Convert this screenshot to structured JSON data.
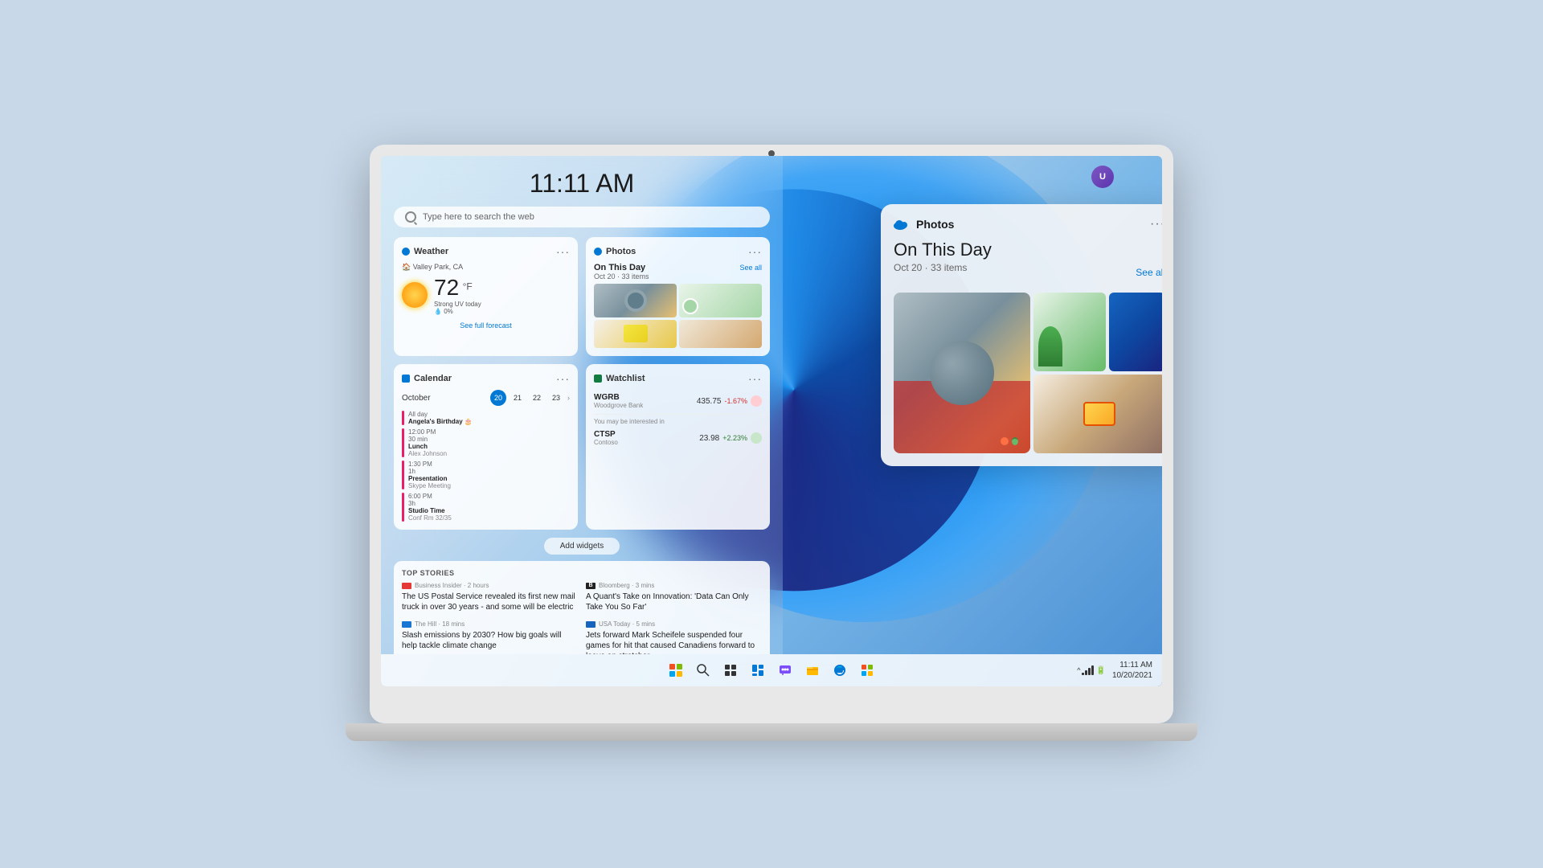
{
  "screen": {
    "time": "11:11 AM",
    "search_placeholder": "Type here to search the web"
  },
  "weather_widget": {
    "title": "Weather",
    "location": "Valley Park, CA",
    "temperature": "72",
    "unit": "°F",
    "condition": "Strong UV today",
    "rain_chance": "0%",
    "forecast_link": "See full forecast"
  },
  "photos_widget": {
    "title": "Photos",
    "section": "On This Day",
    "date": "Oct 20 · 33 items",
    "see_all": "See all"
  },
  "calendar_widget": {
    "title": "Calendar",
    "month": "October",
    "dates": [
      "20",
      "21",
      "22",
      "23"
    ],
    "active_date": "20",
    "events": [
      {
        "type": "allday",
        "name": "Angela's Birthday 🎂",
        "time": "All day",
        "sub": ""
      },
      {
        "time": "12:00 PM",
        "duration": "30 min",
        "name": "Lunch",
        "sub": "Alex Johnson"
      },
      {
        "time": "1:30 PM",
        "duration": "1h",
        "name": "Presentation",
        "sub": "Skype Meeting"
      },
      {
        "time": "6:00 PM",
        "duration": "3h",
        "name": "Studio Time",
        "sub": "Conf Rm 32/35"
      }
    ]
  },
  "watchlist_widget": {
    "title": "Watchlist",
    "stocks": [
      {
        "symbol": "WGRB",
        "company": "Woodgrove Bank",
        "price": "435.75",
        "change": "-1.67%",
        "positive": false
      },
      {
        "symbol": "CTSP",
        "company": "Contoso",
        "price": "23.98",
        "change": "+2.23%",
        "positive": true
      }
    ],
    "interested_label": "You may be interested in"
  },
  "add_widgets_btn": "Add widgets",
  "news": {
    "top_stories": "TOP STORIES",
    "articles": [
      {
        "source": "Business Insider",
        "time": "2 hours",
        "headline": "The US Postal Service revealed its first new mail truck in over 30 years - and some will be electric"
      },
      {
        "source": "Bloomberg",
        "time": "3 mins",
        "headline": "A Quant's Take on Innovation: 'Data Can Only Take You So Far'"
      },
      {
        "source": "The Hill",
        "time": "18 mins",
        "headline": "Slash emissions by 2030? How big goals will help tackle climate change"
      },
      {
        "source": "USA Today",
        "time": "5 mins",
        "headline": "Jets forward Mark Scheifele suspended four games for hit that caused Canadiens forward to leave on stretcher"
      }
    ]
  },
  "photos_expanded": {
    "title": "Photos",
    "dots": "...",
    "on_this_day": "On This Day",
    "date": "Oct 20 · 33 items",
    "see_all": "See all"
  },
  "taskbar": {
    "time": "11:11 AM",
    "date": "10/20/2021",
    "icons": [
      "windows",
      "search",
      "task-view",
      "widgets",
      "chat",
      "explorer",
      "edge",
      "store"
    ]
  }
}
